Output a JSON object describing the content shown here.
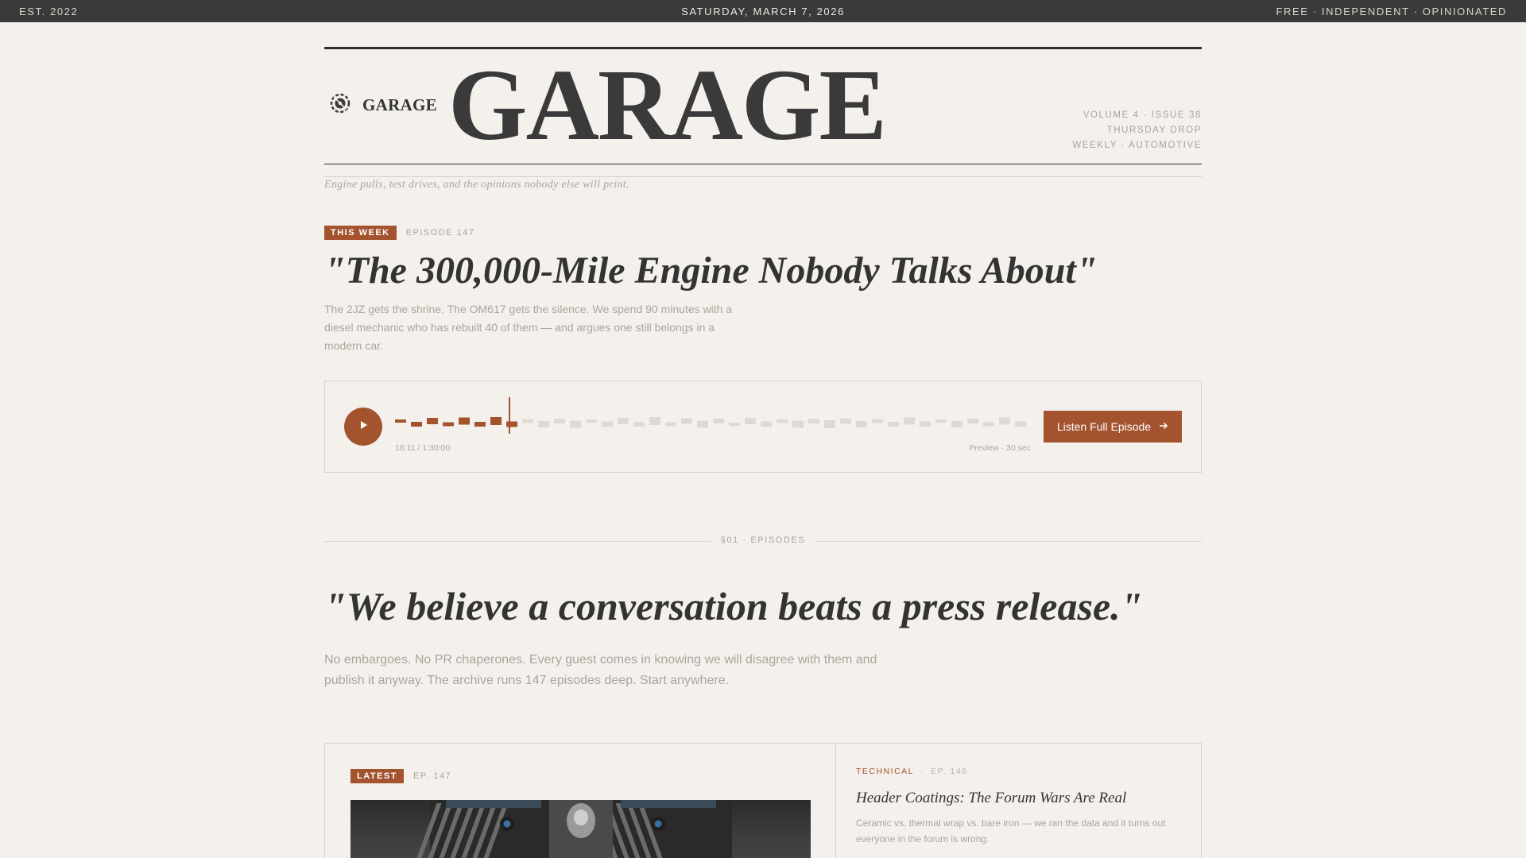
{
  "topbar": {
    "left": "EST. 2022",
    "center": "SATURDAY, MARCH 7, 2026",
    "right": "FREE · INDEPENDENT · OPINIONATED"
  },
  "masthead": {
    "brand": "GARAGE",
    "title": "GARAGE",
    "meta": [
      "VOLUME 4 · ISSUE 38",
      "THURSDAY DROP",
      "WEEKLY · AUTOMOTIVE"
    ],
    "tagline": "Engine pulls, test drives, and the opinions nobody else will print."
  },
  "this_week": {
    "badge": "THIS WEEK",
    "episode": "EPISODE 147",
    "headline": "\"The 300,000-Mile Engine Nobody Talks About\"",
    "dek": "The 2JZ gets the shrine. The OM617 gets the silence. We spend 90 minutes with a diesel mechanic who has rebuilt 40 of them — and argues one still belongs in a modern car."
  },
  "player": {
    "time": "16:11 / 1:30:00",
    "preview": "Preview · 30 sec",
    "progress": 0.18,
    "listen_label": "Listen Full Episode",
    "accent": "#a4532f"
  },
  "episodes_section": {
    "label": "§01 · EPISODES",
    "pull_quote": "\"We believe a conversation beats a press release.\"",
    "sub": "No embargoes. No PR chaperones. Every guest comes in knowing we will disagree with them and publish it anyway. The archive runs 147 episodes deep. Start anywhere."
  },
  "latest_card": {
    "badge": "LATEST",
    "episode": "EP. 147"
  },
  "side_card": {
    "category": "TECHNICAL",
    "separator": "·",
    "episode": "EP. 146",
    "title": "Header Coatings: The Forum Wars Are Real",
    "desc": "Ceramic vs. thermal wrap vs. bare iron — we ran the data and it turns out everyone in the forum is wrong."
  }
}
